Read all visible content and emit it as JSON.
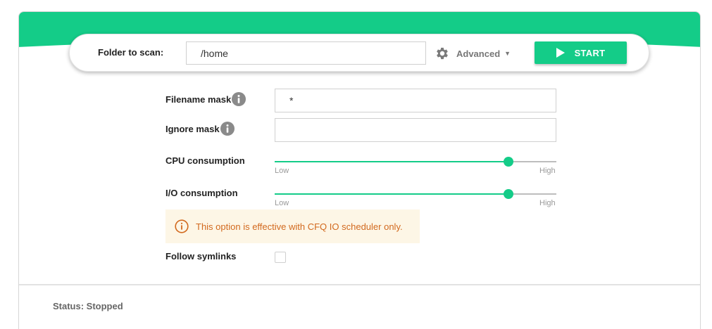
{
  "scan_bar": {
    "folder_label": "Folder to scan:",
    "folder_value": "/home",
    "advanced_label": "Advanced",
    "start_label": "START"
  },
  "options": {
    "filename_mask_label": "Filename mask",
    "filename_mask_value": "*",
    "ignore_mask_label": "Ignore mask",
    "ignore_mask_value": "",
    "cpu_label": "CPU consumption",
    "cpu_level": 0.83,
    "io_label": "I/O consumption",
    "io_level": 0.83,
    "slider_low": "Low",
    "slider_high": "High",
    "warning_text": "This option is effective with CFQ IO scheduler only.",
    "follow_symlinks_label": "Follow symlinks",
    "follow_symlinks_checked": false
  },
  "status": {
    "text": "Status: Stopped"
  },
  "colors": {
    "accent": "#14cc88",
    "warning_bg": "#fdf6e6",
    "warning_text": "#d2691e",
    "icon_gray": "#7a7a7a"
  },
  "icons": {
    "advanced": "gear-icon",
    "start": "play-icon",
    "info": "info-icon",
    "warning": "warning-circle-icon"
  }
}
